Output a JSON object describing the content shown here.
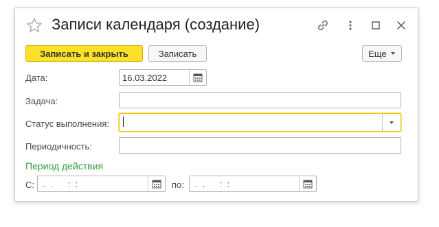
{
  "window": {
    "title": "Записи календаря (создание)"
  },
  "toolbar": {
    "save_close_label": "Записать и закрыть",
    "save_label": "Записать",
    "more_label": "Еще"
  },
  "form": {
    "date_label": "Дата:",
    "date_value": "16.03.2022",
    "task_label": "Задача:",
    "task_value": "",
    "status_label": "Статус выполнения:",
    "status_value": "",
    "periodicity_label": "Периодичность:",
    "periodicity_value": ""
  },
  "period": {
    "title": "Период действия",
    "from_label": "С:",
    "from_value": " .  .      :  :",
    "to_label": "по:",
    "to_value": " .  .      :  :"
  },
  "colors": {
    "primary_button": "#fbe128",
    "section_title": "#2f9d3f",
    "focus_border": "#f0c419"
  }
}
